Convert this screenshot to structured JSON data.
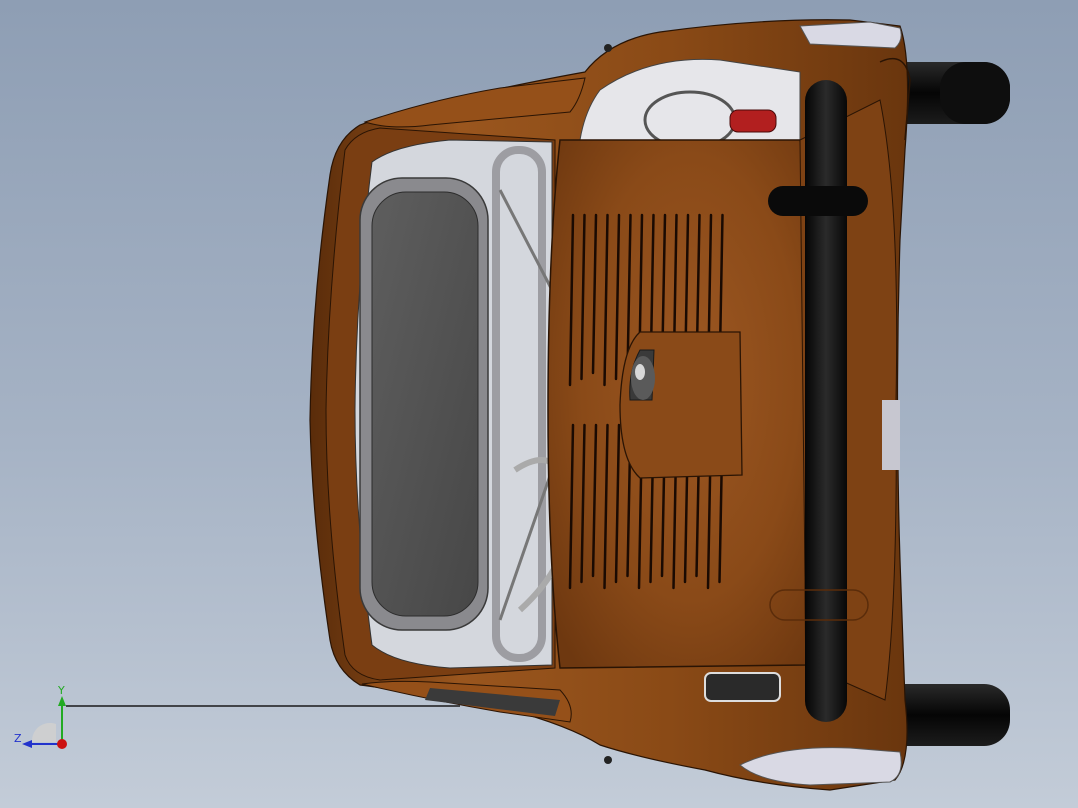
{
  "viewport": {
    "background_top": "#8e9eb4",
    "background_bottom": "#c3ccd8"
  },
  "model": {
    "body_color": "#8a4a16",
    "body_highlight": "#b0652a",
    "body_shadow": "#4a2408",
    "tire_color": "#101010",
    "window_color": "#555555",
    "trim_color": "#c8c8cc",
    "tail_light_color": "#b21f1f"
  },
  "triad": {
    "y_label": "Y",
    "z_label": "Z",
    "y_color": "#22aa22",
    "z_color": "#2233cc",
    "x_color": "#cc1111"
  }
}
